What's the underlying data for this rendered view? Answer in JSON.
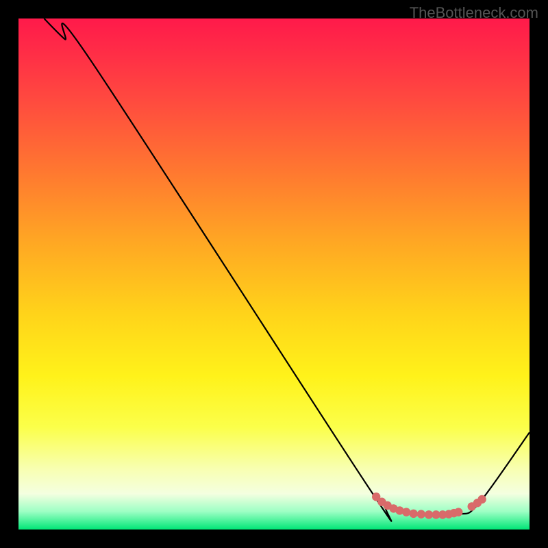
{
  "watermark": "TheBottleneck.com",
  "chart_data": {
    "type": "line",
    "title": "",
    "xlabel": "",
    "ylabel": "",
    "xlim": [
      0,
      100
    ],
    "ylim": [
      0,
      100
    ],
    "curve": [
      {
        "x": 5,
        "y": 100
      },
      {
        "x": 9,
        "y": 96
      },
      {
        "x": 14,
        "y": 92
      },
      {
        "x": 68,
        "y": 9
      },
      {
        "x": 72,
        "y": 4.5
      },
      {
        "x": 78,
        "y": 3
      },
      {
        "x": 86,
        "y": 3
      },
      {
        "x": 90,
        "y": 5
      },
      {
        "x": 100,
        "y": 19
      }
    ],
    "markers": [
      {
        "x": 70,
        "y": 6.4
      },
      {
        "x": 71.1,
        "y": 5.4
      },
      {
        "x": 72.2,
        "y": 4.7
      },
      {
        "x": 73.4,
        "y": 4.1
      },
      {
        "x": 74.6,
        "y": 3.7
      },
      {
        "x": 75.9,
        "y": 3.4
      },
      {
        "x": 77.3,
        "y": 3.1
      },
      {
        "x": 78.8,
        "y": 3.0
      },
      {
        "x": 80.3,
        "y": 2.9
      },
      {
        "x": 81.7,
        "y": 2.9
      },
      {
        "x": 83.0,
        "y": 2.9
      },
      {
        "x": 84.2,
        "y": 3.0
      },
      {
        "x": 85.2,
        "y": 3.2
      },
      {
        "x": 86.1,
        "y": 3.4
      },
      {
        "x": 88.7,
        "y": 4.5
      },
      {
        "x": 89.8,
        "y": 5.2
      },
      {
        "x": 90.7,
        "y": 5.9
      }
    ],
    "marker_color": "#d96a6a"
  }
}
